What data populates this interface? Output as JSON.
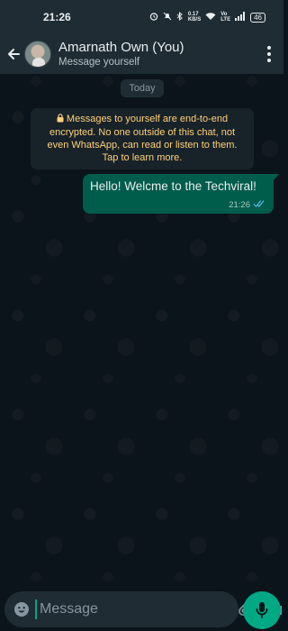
{
  "status_bar": {
    "time": "21:26",
    "net_speed": "0.17\nKB/S",
    "battery": "46"
  },
  "header": {
    "title": "Amarnath Own (You)",
    "subtitle": "Message yourself"
  },
  "chat": {
    "date_chip": "Today",
    "e2e_notice": "Messages to yourself are end-to-end encrypted. No one outside of this chat, not even WhatsApp, can read or listen to them. Tap to learn more.",
    "messages": [
      {
        "text": "Hello! Welcme to the Techviral!",
        "time": "21:26",
        "status": "read"
      }
    ]
  },
  "composer": {
    "placeholder": "Message"
  },
  "colors": {
    "accent": "#00a884",
    "outgoing_bubble": "#005c4b",
    "notice_text": "#ffd279",
    "read_ticks": "#53bdeb"
  }
}
